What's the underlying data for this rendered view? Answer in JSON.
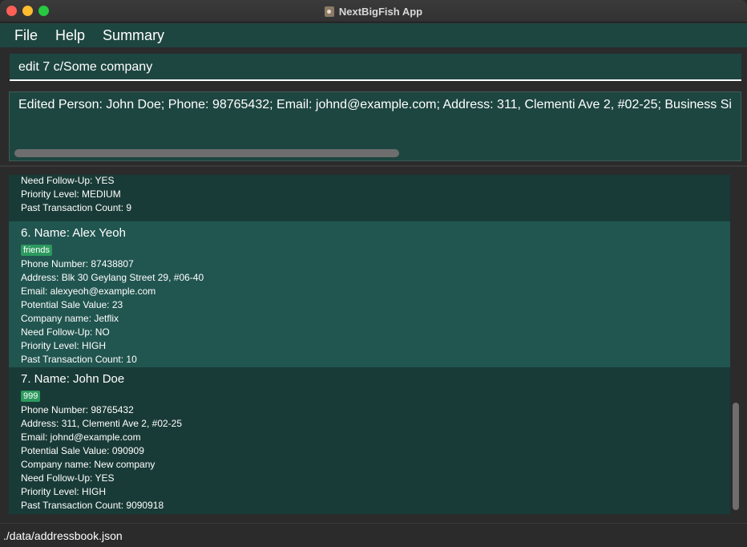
{
  "window": {
    "title": "NextBigFish App"
  },
  "menu": {
    "file": "File",
    "help": "Help",
    "summary": "Summary"
  },
  "command": {
    "value": "edit 7 c/Some company"
  },
  "result": {
    "text": "Edited Person: John Doe; Phone: 98765432; Email: johnd@example.com; Address: 311, Clementi Ave 2, #02-25; Business Si"
  },
  "persons": [
    {
      "follow_up": "Need Follow-Up: YES",
      "priority": "Priority Level: MEDIUM",
      "transactions": "Past Transaction Count: 9"
    },
    {
      "index_name": "6.  Name: Alex Yeoh",
      "tag": "friends",
      "phone": "Phone Number: 87438807",
      "address": "Address: Blk 30 Geylang Street 29, #06-40",
      "email": "Email: alexyeoh@example.com",
      "sale_value": "Potential Sale Value: 23",
      "company": "Company name: Jetflix",
      "follow_up": "Need Follow-Up: NO",
      "priority": "Priority Level: HIGH",
      "transactions": "Past Transaction Count: 10"
    },
    {
      "index_name": "7.  Name: John Doe",
      "tag": "999",
      "phone": "Phone Number: 98765432",
      "address": "Address: 311, Clementi Ave 2, #02-25",
      "email": "Email: johnd@example.com",
      "sale_value": "Potential Sale Value: 090909",
      "company": "Company name: New company",
      "follow_up": "Need Follow-Up: YES",
      "priority": "Priority Level: HIGH",
      "transactions": "Past Transaction Count: 9090918"
    }
  ],
  "status": {
    "path": "./data/addressbook.json"
  },
  "colors": {
    "panel": "#1e4641",
    "card_dark": "#193b37",
    "card_light": "#215550",
    "tag": "#2c9a5e",
    "background": "#2b2b2b"
  }
}
